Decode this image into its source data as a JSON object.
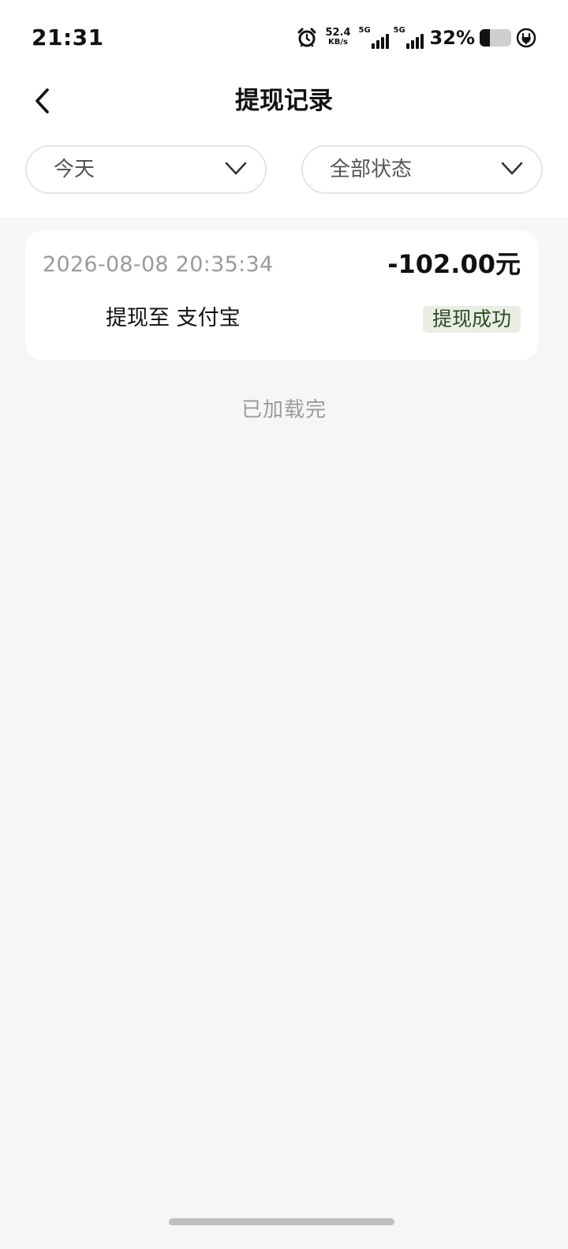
{
  "status_bar": {
    "time": "21:31",
    "net_speed_value": "52.4",
    "net_speed_unit": "KB/s",
    "sim1_label": "5G",
    "sim2_label": "5G",
    "battery_percent_text": "32%",
    "battery_level": 0.32,
    "icons": [
      "alarm-icon",
      "signal-icon",
      "signal-icon",
      "battery-icon",
      "charging-icon"
    ]
  },
  "header": {
    "title": "提现记录",
    "back_icon": "chevron-left-icon"
  },
  "filters": {
    "date": {
      "label": "今天",
      "icon": "chevron-down-icon"
    },
    "status": {
      "label": "全部状态",
      "icon": "chevron-down-icon"
    }
  },
  "records": [
    {
      "time": "2026-08-08 20:35:34",
      "amount": "-102.00元",
      "destination": "提现至 支付宝",
      "status": "提现成功"
    }
  ],
  "footer": {
    "load_complete": "已加载完"
  },
  "colors": {
    "page_background": "#f5f6f8",
    "card_background": "#ffffff",
    "status_badge_background": "#e8eee4",
    "status_badge_text": "#2f4a22",
    "muted_text": "#9a9a9a"
  }
}
